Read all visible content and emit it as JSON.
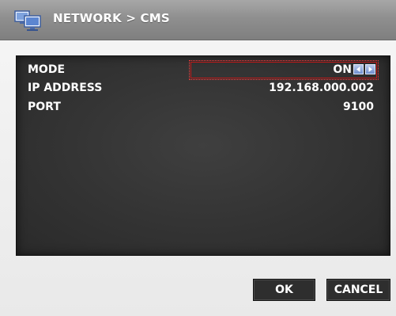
{
  "header": {
    "title": "NETWORK > CMS",
    "icon": "network-computers-icon"
  },
  "settings": {
    "mode": {
      "label": "MODE",
      "value": "ON"
    },
    "ip_address": {
      "label": "IP ADDRESS",
      "value": "192.168.000.002"
    },
    "port": {
      "label": "PORT",
      "value": "9100"
    }
  },
  "buttons": {
    "ok": "OK",
    "cancel": "CANCEL"
  },
  "colors": {
    "highlight": "#e02020",
    "arrow_blue": "#6f8fcf"
  }
}
